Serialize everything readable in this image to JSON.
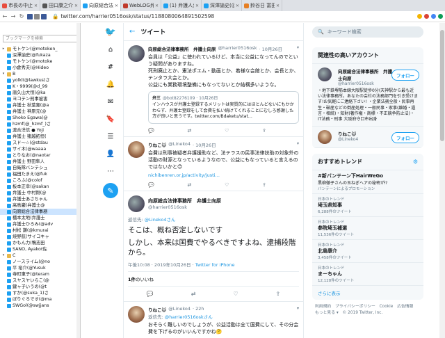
{
  "browser": {
    "tabs": [
      {
        "title": "市長の中止呼びかけ",
        "color": "#e84c3d",
        "active": false
      },
      {
        "title": "田口康之介と小保",
        "color": "#555",
        "active": false
      },
      {
        "title": "向原総合法律事務所",
        "color": "#1da1f2",
        "active": true
      },
      {
        "title": "WebLOG弁護士中村",
        "color": "#c0392b",
        "active": false
      },
      {
        "title": "(1) 弁護人弁護士表",
        "color": "#1da1f2",
        "active": false
      },
      {
        "title": "深澤諭史(@fukazaw",
        "color": "#1da1f2",
        "active": false
      },
      {
        "title": "鈴谷日 富田日",
        "color": "#e67e22",
        "active": false
      }
    ],
    "url": "twitter.com/harrier0516osk/status/1188080064891502598",
    "nav": {
      "back": "←",
      "forward": "→",
      "reload": "↻"
    }
  },
  "bookmarks": {
    "search_placeholder": "ブックマークを検索",
    "items": [
      {
        "label": "モトケン(@motoken_",
        "folder": true,
        "expand": "▸"
      },
      {
        "label": "深澤諭史(@fukaza",
        "folder": false
      },
      {
        "label": "モトケン(@motoke",
        "folder": false
      },
      {
        "label": "小倉秀夫(@Hideo",
        "folder": false
      },
      {
        "label": "B",
        "folder": true,
        "expand": "▾"
      },
      {
        "label": "yolkl(@lawkus)さ",
        "folder": false
      },
      {
        "label": "K・9999(@d_99",
        "folder": false
      },
      {
        "label": "唐久山大恒(@ka",
        "folder": false
      },
      {
        "label": "ヨコテン刑事被害",
        "folder": false
      },
      {
        "label": "弁護士 秋葉寛(@a",
        "folder": false
      },
      {
        "label": "弁護士 神原元(@",
        "folder": false
      },
      {
        "label": "Shoko Egawa(@",
        "folder": false
      },
      {
        "label": "hzmf(@_hzmf_)さ",
        "folder": false
      },
      {
        "label": "渡合洋信 ● Yoji",
        "folder": false
      },
      {
        "label": "弁護士 猪越拓恒(",
        "folder": false
      },
      {
        "label": "スド～☆(@stdau",
        "folder": false
      },
      {
        "label": "サイ木(@waaaa",
        "folder": false
      },
      {
        "label": "とりなお(@naotar",
        "folder": false
      },
      {
        "label": "弁護士 野田隼人",
        "folder": false
      },
      {
        "label": "自衛隊バンテシュ",
        "folder": false
      },
      {
        "label": "福田たまえ(@fuk",
        "folder": false
      },
      {
        "label": "ころふ(@colof",
        "folder": false
      },
      {
        "label": "板本正幸(@sakan",
        "folder": false
      },
      {
        "label": "弁護士 中村剛(@",
        "folder": false
      },
      {
        "label": "弁護士あさちゃん",
        "folder": false
      },
      {
        "label": "高島巌(弁護士@",
        "folder": false
      },
      {
        "label": "向原総合法律事務",
        "folder": false,
        "selected": true
      },
      {
        "label": "橋本太地(弁護士",
        "folder": false
      },
      {
        "label": "弁護士ひろみ(@adv",
        "folder": false
      },
      {
        "label": "村松 謙(@kmurai",
        "folder": false
      },
      {
        "label": "焼野航(サイコキャ",
        "folder": false
      },
      {
        "label": "かもん力(鴨志田",
        "folder": false
      },
      {
        "label": "SANO, Ayako(佐",
        "folder": false
      },
      {
        "label": "C",
        "folder": true,
        "expand": "▾"
      },
      {
        "label": "ノースライム(@no",
        "folder": false
      },
      {
        "label": "平 裕介(@Yusuk",
        "folder": false
      },
      {
        "label": "寺町東子(@teram",
        "folder": false
      },
      {
        "label": "スヤスヤいらこ(@",
        "folder": false
      },
      {
        "label": "鍵ャ子いうの(@t",
        "folder": false
      },
      {
        "label": "すか(@suka_1)さ",
        "folder": false
      },
      {
        "label": "ぼりぐろです(@ma",
        "folder": false
      },
      {
        "label": "SWGol(@swjjans",
        "folder": false
      }
    ]
  },
  "twitter_nav": [
    "bird-logo",
    "home",
    "explore",
    "notifications",
    "messages",
    "bookmarks",
    "lists",
    "profile",
    "more"
  ],
  "main": {
    "header_title": "ツイート",
    "tweets": [
      {
        "avatar": "hk",
        "name": "向原総合法律事務所　弁護士向原",
        "handle": "@harrier0516osk",
        "time": "· 10月26日",
        "text": "会員は「公益」に使われているけど、本当に公益になってんのでという疑問がありますね。\n死刑廃止とか、憲法ポエム・動画とか、着様な会館とか、会長とか、テンタラ大会とか。\n公益にも業務環境整備にもなってないとか結構多いような。",
        "quote": {
          "name": "弁三",
          "handle": "@bot82276109 · 10月26日",
          "text": "インハウスが弁護士登録するメリットは実質的にはほとんどないにもかかわらず、弁護士登録をして会費を払い続けてくれることにむしろ感謝した方が良いと思うです。twitter.com/Bdaketu/stat…"
        }
      },
      {
        "avatar": "rn",
        "name": "りねこ😺",
        "handle": "@Lineko4",
        "time": "· 10月26日",
        "text": "会費は刑事被疑者弁護援助など、法テラスの民事法律扶助の対象外の活動の財源となっているようなので、公益にもなっていると言えるのではないかと😊",
        "link": "nichibenren.or.jp/activity/justi…"
      }
    ],
    "focus": {
      "name": "向原総合法律事務所　弁護士向原",
      "handle": "@harrier0516osk",
      "reply_prefix": "返信先: ",
      "reply_target": "@Lineko4さん",
      "text1": "そこは、概ね否定しないです",
      "text2": "しかし、本来は国費でやるべきですよね、逮捕段階から。",
      "time": "午後10:08 · 2019年10月26日 · ",
      "client": "Twitter for iPhone",
      "likes_count": "1件",
      "likes_label": "のいいね"
    },
    "reply": {
      "name": "りねこ😺",
      "handle": "@Lineko4",
      "time": "· 22h",
      "reply_prefix": "返信先: ",
      "reply_target": "@harrier0516oskさん",
      "text": "おそらく難しいのでしょうが、公益活動は全て国費にして、その分会費を下げるのがいいんですかね🤔"
    },
    "action_icons": [
      "💬",
      "⇄",
      "♡",
      "⇪"
    ]
  },
  "right": {
    "search_placeholder": "キーワード検索",
    "related_title": "関連性の高いアカウント",
    "accounts": [
      {
        "avatar": "hk",
        "name": "向原総合法律事務所　弁護士向原",
        "handle": "@harrier0516osk",
        "follow": "フォロー",
        "bio": "・地下鉄堺筋本線大阪駅徒歩0分(天神駅から最も近い法律事務所。あなたの会社の法務部門を引き受けます!お気軽にご連絡下さい! ・企業法務全般・民事再生・破産などの倒産処理・一般民事・家事(離婚・遺言・相続)・知財(著作権・商標・不正競争防止法)・IT法務・刑事 大阪府守口市出身"
      },
      {
        "avatar": "rn",
        "name": "りねこ😺",
        "handle": "@Lineko4",
        "follow": "フォロー",
        "bio": ""
      }
    ],
    "trends_title": "おすすめトレンド",
    "trends": [
      {
        "cat": "",
        "name": "#新バンテーン下HairWeGo",
        "desc": "黒柳徹子さんの玉ねぎヘアの秘密が⁉",
        "cnt": "",
        "promo": "バンテーンによるプロモーション"
      },
      {
        "cat": "日本のトレンド",
        "name": "埼玉県知事",
        "desc": "",
        "cnt": "6,288件のツイート",
        "promo": ""
      },
      {
        "cat": "日本のトレンド",
        "name": "参院埼玉補選",
        "desc": "",
        "cnt": "11,536件のツイート",
        "promo": ""
      },
      {
        "cat": "日本のトレンド",
        "name": "北島康介",
        "desc": "",
        "cnt": "3,458件のツイート",
        "promo": ""
      },
      {
        "cat": "日本のトレンド",
        "name": "まーちゃん",
        "desc": "",
        "cnt": "12,128件のツイート",
        "promo": ""
      }
    ],
    "more": "さらに表示",
    "footer": "利用規約　プライバシーポリシー　Cookie　広告情報\nもっと見る ▾　© 2019 Twitter, Inc."
  }
}
